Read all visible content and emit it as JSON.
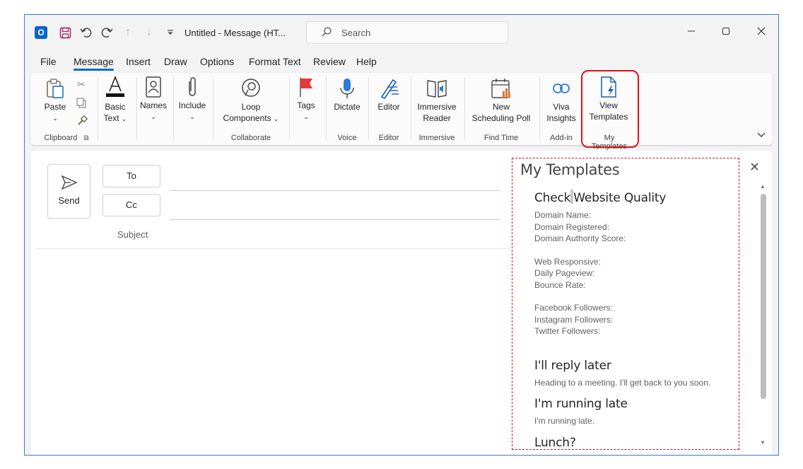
{
  "titlebar": {
    "doc_title": "Untitled  -  Message (HT...",
    "search_placeholder": "Search",
    "app_logo": "O"
  },
  "menu": {
    "tabs": [
      "File",
      "Message",
      "Insert",
      "Draw",
      "Options",
      "Format Text",
      "Review",
      "Help"
    ],
    "active": "Message"
  },
  "ribbon": {
    "paste": "Paste",
    "basic_text": [
      "Basic",
      "Text"
    ],
    "names": "Names",
    "include": "Include",
    "loop": [
      "Loop",
      "Components"
    ],
    "tags": "Tags",
    "dictate": "Dictate",
    "editor": "Editor",
    "immersive": [
      "Immersive",
      "Reader"
    ],
    "new_poll": [
      "New",
      "Scheduling Poll"
    ],
    "viva": [
      "Viva",
      "Insights"
    ],
    "view_templates": [
      "View",
      "Templates"
    ],
    "groups": {
      "clipboard": "Clipboard",
      "collaborate": "Collaborate",
      "voice": "Voice",
      "editor": "Editor",
      "immersive": "Immersive",
      "find_time": "Find Time",
      "add_in": "Add-in",
      "my_templates": "My Templates"
    },
    "highlight_color": "#d9141d",
    "accent": "#0f6cbd"
  },
  "compose": {
    "send": "Send",
    "to": "To",
    "cc": "Cc",
    "subject": "Subject"
  },
  "templates": {
    "pane_title": "My Templates",
    "items": [
      {
        "title_a": "Check",
        "title_b": "Website Quality",
        "lines": [
          [
            "Domain Name:",
            "Domain Registered:",
            "Domain Authority Score:"
          ],
          [
            "Web Responsive:",
            "Daily Pageview:",
            "Bounce Rate:"
          ],
          [
            "Facebook Followers:",
            "Instagram Followers:",
            "Twitter Followers:"
          ]
        ]
      },
      {
        "title": "I'll reply later",
        "body": "Heading to a meeting. I'll get back to you soon."
      },
      {
        "title": "I'm running late",
        "body": "I'm running late."
      },
      {
        "title": "Lunch?"
      }
    ]
  }
}
